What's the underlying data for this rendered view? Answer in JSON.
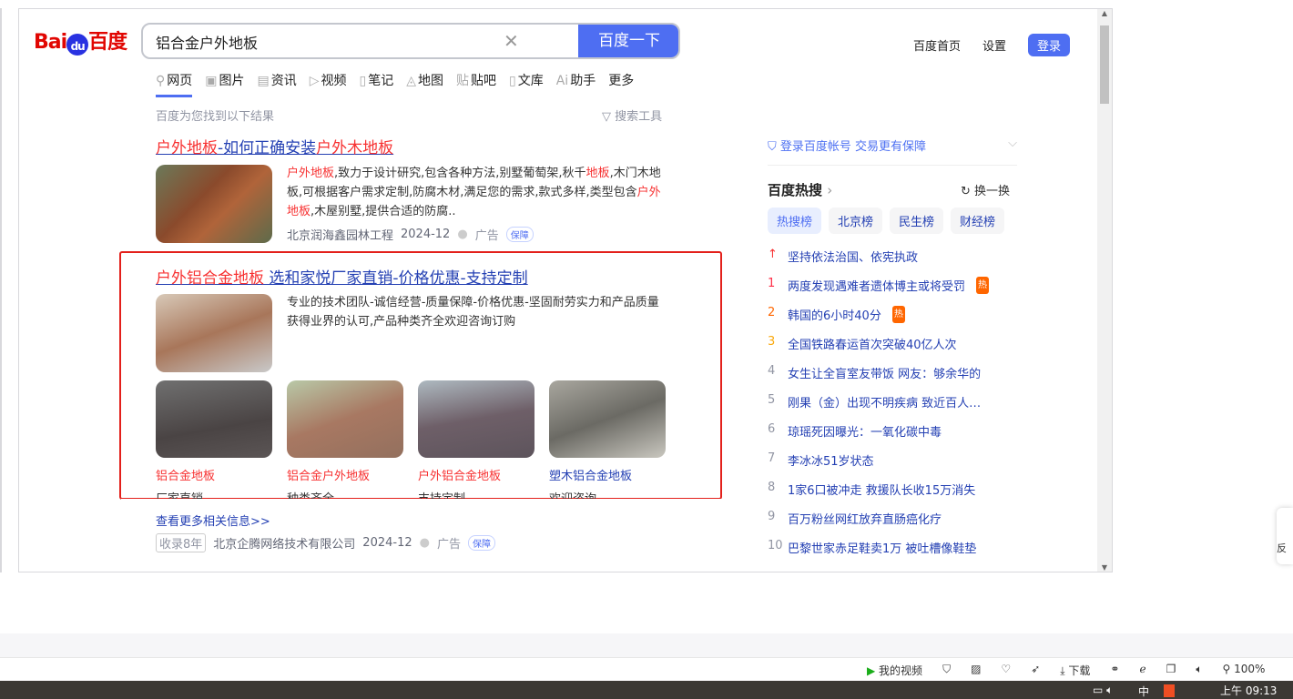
{
  "search": {
    "query": "铝合金户外地板",
    "button": "百度一下"
  },
  "logo": {
    "text": "Bai",
    "paw": "du",
    "cn": "百度"
  },
  "top_links": [
    "百度首页",
    "设置",
    "登录"
  ],
  "tabs": [
    "网页",
    "图片",
    "资讯",
    "视频",
    "笔记",
    "地图",
    "贴吧",
    "文库",
    "助手",
    "更多"
  ],
  "found": "百度为您找到以下结果",
  "search_tools": "搜索工具",
  "result1": {
    "title_parts": [
      "户外地板",
      "-如何正确安装",
      "户外木地板"
    ],
    "desc_parts": [
      "户外地板",
      ",致力于设计研究,包含各种方法,别墅葡萄架,秋千",
      "地板",
      ",木门木地板,可根据客户需求定制,防腐木材,满足您的需求,款式多样,类型包含",
      "户外地板",
      ",木屋别墅,提供合适的防腐.."
    ],
    "source": "北京润海鑫园林工程",
    "date": "2024-12",
    "ad": "广告",
    "badge": "保障"
  },
  "result2": {
    "title_parts": [
      "户外铝合金地板",
      " 选和家悦厂家直销-价格优惠-支持定制"
    ],
    "desc": "专业的技术团队-诚信经营-质量保障-价格优惠-坚固耐劳实力和产品质量获得业界的认可,产品种类齐全欢迎咨询订购",
    "subs": [
      {
        "link": "铝合金地板",
        "sub": "厂家直销"
      },
      {
        "link": "铝合金户外地板",
        "sub": "种类齐全"
      },
      {
        "link": "户外铝合金地板",
        "sub": "支持定制"
      },
      {
        "link": "塑木铝合金地板",
        "sub": "欢迎咨询"
      }
    ],
    "more": "查看更多相关信息>>",
    "tag": "收录8年",
    "source": "北京企腾网络技术有限公司",
    "date": "2024-12",
    "ad": "广告",
    "badge": "保障"
  },
  "right": {
    "guard": "登录百度帐号 交易更有保障",
    "hot_title": "百度热搜",
    "refresh": "换一换",
    "lists": [
      "热搜榜",
      "北京榜",
      "民生榜",
      "财经榜"
    ],
    "items": [
      {
        "n": "↑",
        "t": "坚持依法治国、依宪执政"
      },
      {
        "n": "1",
        "t": "两度发现遇难者遗体博主或将受罚",
        "b": "热"
      },
      {
        "n": "2",
        "t": "韩国的6小时40分",
        "b": "热"
      },
      {
        "n": "3",
        "t": "全国铁路春运首次突破40亿人次"
      },
      {
        "n": "4",
        "t": "女生让全盲室友带饭 网友：够余华的"
      },
      {
        "n": "5",
        "t": "刚果（金）出现不明疾病 致近百人…"
      },
      {
        "n": "6",
        "t": "琼瑶死因曝光：一氧化碳中毒"
      },
      {
        "n": "7",
        "t": "李冰冰51岁状态"
      },
      {
        "n": "8",
        "t": "1家6口被冲走 救援队长收15万消失"
      },
      {
        "n": "9",
        "t": "百万粉丝网红放弃直肠癌化疗"
      },
      {
        "n": "10",
        "t": "巴黎世家赤足鞋卖1万 被吐槽像鞋垫"
      }
    ]
  },
  "status": {
    "video": "我的视频",
    "download": "下载",
    "zoom": "100%"
  },
  "taskbar": {
    "ime": "中",
    "time": "上午 09:13"
  },
  "side": "反"
}
